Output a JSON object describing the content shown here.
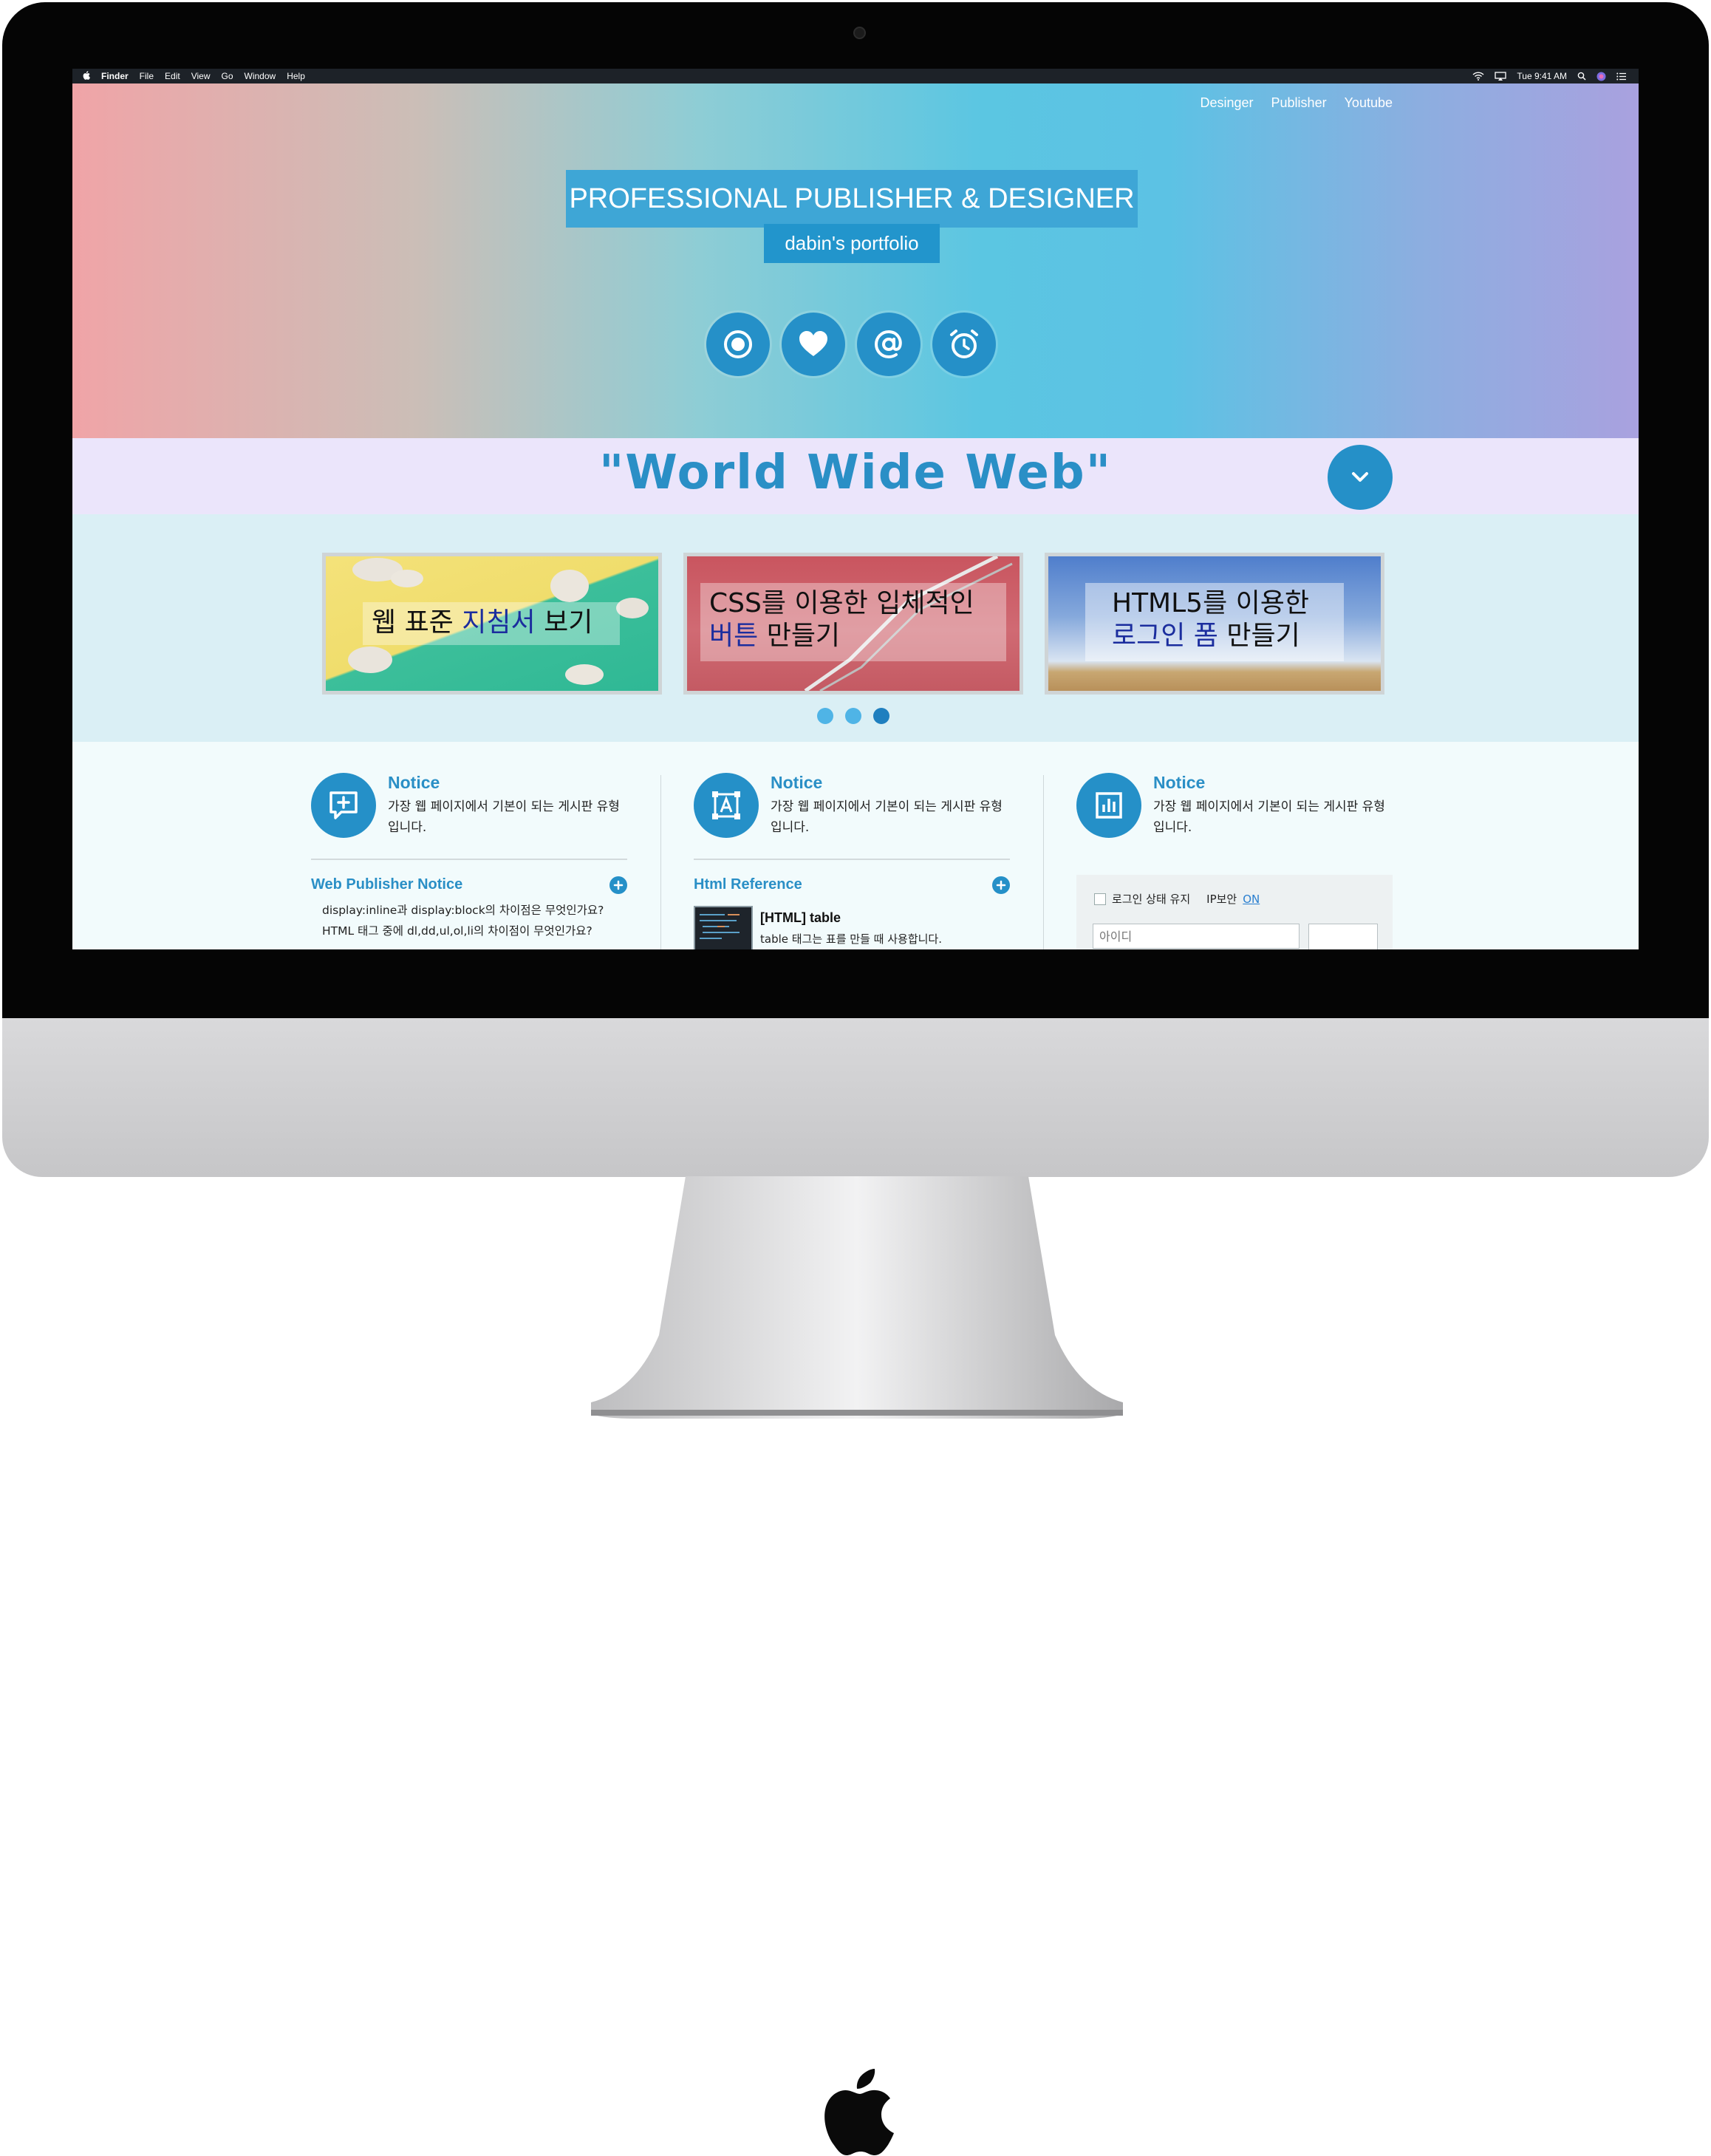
{
  "colors": {
    "accent": "#2590c8",
    "title_bar": "#3ea6d6",
    "banner_bg": "#ebe5fb",
    "slider_bg": "#daeff5",
    "highlight_text": "#1b2d9e"
  },
  "menubar": {
    "app_name": "Finder",
    "menus": [
      "File",
      "Edit",
      "View",
      "Go",
      "Window",
      "Help"
    ],
    "clock": "Tue 9:41 AM"
  },
  "nav": {
    "items": [
      "Desinger",
      "Publisher",
      "Youtube"
    ]
  },
  "hero": {
    "title": "PROFESSIONAL PUBLISHER & DESIGNER",
    "subtitle": "dabin's portfolio",
    "icons": [
      "target-icon",
      "heart-icon",
      "at-sign-icon",
      "alarm-clock-icon"
    ]
  },
  "banner": {
    "text": "\"World Wide Web\""
  },
  "slider": {
    "slides": [
      {
        "line1_pre": "웹 표준 ",
        "line1_hl": "지침서",
        "line1_post": " 보기",
        "line2_hl": "",
        "line2_post": ""
      },
      {
        "line1_pre": "CSS를 이용한 입체적인",
        "line1_hl": "",
        "line1_post": "",
        "line2_hl": "버튼",
        "line2_post": " 만들기"
      },
      {
        "line1_pre": "HTML5를 이용한",
        "line1_hl": "",
        "line1_post": "",
        "line2_hl": "로그인 폼",
        "line2_post": " 만들기"
      }
    ],
    "active_dot": 3
  },
  "columns": [
    {
      "icon": "plus-message-icon",
      "title": "Notice",
      "desc": "가장 웹 페이지에서 기본이 되는 게시판 유형 입니다.",
      "sub_head": "Web Publisher Notice",
      "items": [
        "display:inline과 display:block의 차이점은 무엇인가요?",
        "HTML 태그 중에 dl,dd,ul,ol,li의 차이점이 무엇인가요?"
      ]
    },
    {
      "icon": "text-frame-icon",
      "title": "Notice",
      "desc": "가장 웹 페이지에서 기본이 되는 게시판 유형 입니다.",
      "sub_head": "Html Reference",
      "ref_title": "[HTML] table",
      "ref_desc": "table 태그는 표를 만들 때 사용합니다."
    },
    {
      "icon": "bar-chart-icon",
      "title": "Notice",
      "desc": "가장 웹 페이지에서 기본이 되는 게시판 유형 입니다.",
      "login": {
        "keep_label": "로그인 상태 유지",
        "ip_label": "IP보안",
        "ip_state": "ON",
        "id_placeholder": "아이디"
      }
    }
  ]
}
